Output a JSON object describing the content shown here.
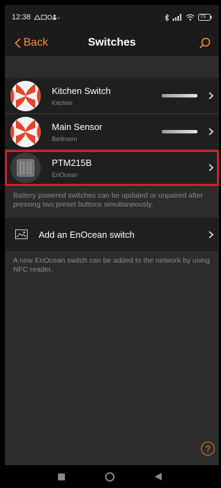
{
  "status": {
    "time": "12:38",
    "battery": "73"
  },
  "nav": {
    "back_label": "Back",
    "title": "Switches"
  },
  "devices": [
    {
      "name": "Kitchen Switch",
      "room": "Kitchen",
      "icon": "fan-logo-icon",
      "has_signal_bar": true
    },
    {
      "name": "Main Sensor",
      "room": "Bedroom",
      "icon": "fan-logo-icon",
      "has_signal_bar": true
    },
    {
      "name": "PTM215B",
      "room": "EnOcean",
      "icon": "wall-switch-icon",
      "has_signal_bar": false,
      "highlighted": true
    }
  ],
  "battery_note": "Battery powered switches can be updated or unpaired after pressing two preset buttons simultaneously.",
  "add_switch_label": "Add an EnOcean switch",
  "nfc_note": "A new EnOcean switch can be added to the network by using NFC reader.",
  "help_label": "?",
  "colors": {
    "accent": "#f0922c",
    "highlight_border": "#d0202a",
    "background": "#2c2c2c",
    "row_background": "#1f1f1f"
  }
}
